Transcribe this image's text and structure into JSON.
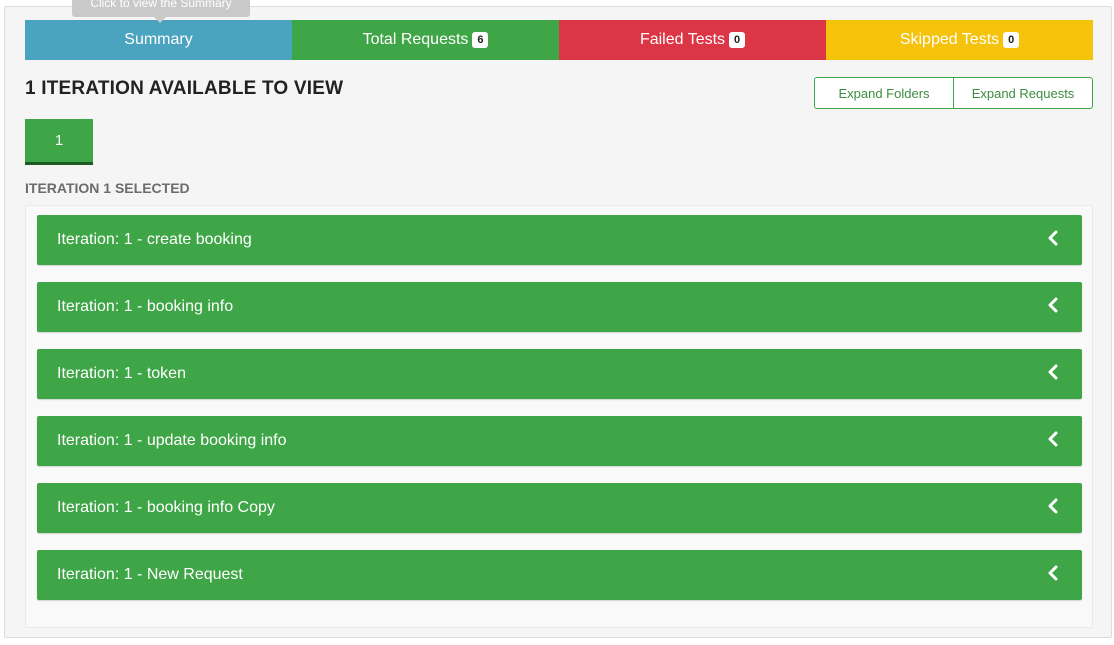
{
  "tooltip": "Click to view the Summary",
  "tabs": {
    "summary": {
      "label": "Summary"
    },
    "total_requests": {
      "label": "Total Requests",
      "count": "6"
    },
    "failed_tests": {
      "label": "Failed Tests",
      "count": "0"
    },
    "skipped_tests": {
      "label": "Skipped Tests",
      "count": "0"
    }
  },
  "heading": "1 ITERATION AVAILABLE TO VIEW",
  "actions": {
    "expand_folders": "Expand Folders",
    "expand_requests": "Expand Requests"
  },
  "iterations": [
    {
      "label": "1"
    }
  ],
  "selected_label": "ITERATION 1 SELECTED",
  "requests": [
    {
      "label": "Iteration: 1 - create booking"
    },
    {
      "label": "Iteration: 1 - booking info"
    },
    {
      "label": "Iteration: 1 - token"
    },
    {
      "label": "Iteration: 1 - update booking info"
    },
    {
      "label": "Iteration: 1 - booking info Copy"
    },
    {
      "label": "Iteration: 1 - New Request"
    }
  ],
  "colors": {
    "summary": "#4aa3bf",
    "total_requests": "#3fa648",
    "failed_tests": "#dc3545",
    "skipped_tests": "#f5c20c",
    "request_row": "#3fa648"
  },
  "icons": {
    "row_toggle": "chevron-left-icon"
  }
}
